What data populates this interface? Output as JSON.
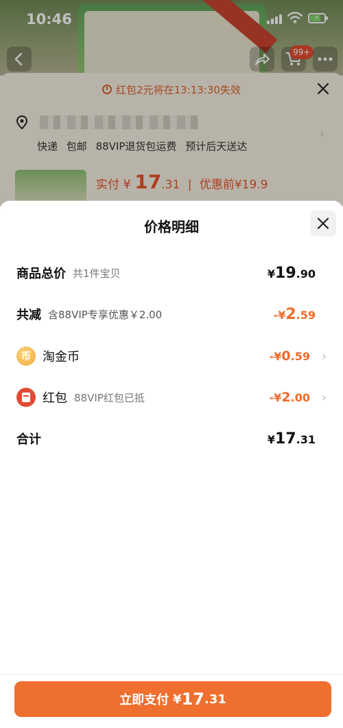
{
  "status_bar": {
    "time": "10:46"
  },
  "header": {
    "cart_badge": "99+"
  },
  "countdown": {
    "text": "红包2元将在13:13:30失效"
  },
  "delivery": {
    "items": [
      "快递",
      "包邮",
      "88VIP退货包运费",
      "预计后天送达"
    ]
  },
  "product_bg": {
    "paid_label": "实付",
    "yen": "¥",
    "price_int": "17",
    "price_dec": ".31",
    "orig_label": "优惠前",
    "orig_price": "¥19.9"
  },
  "modal": {
    "title": "价格明细",
    "rows": {
      "total_goods": {
        "label": "商品总价",
        "sub": "共1件宝贝",
        "yen": "¥",
        "int": "19",
        "dec": ".90"
      },
      "discount": {
        "label": "共减",
        "sub": "含88VIP专享优惠￥2.00",
        "prefix": "-¥",
        "int": "2",
        "dec": ".59"
      },
      "taojinbi": {
        "icon_char": "币",
        "label": "淘金币",
        "prefix": "-¥",
        "int": "0",
        "dec": ".59"
      },
      "hongbao": {
        "label": "红包",
        "sub": "88VIP红包已抵",
        "prefix": "-¥",
        "int": "2",
        "dec": ".00"
      },
      "sum": {
        "label": "合计",
        "yen": "¥",
        "int": "17",
        "dec": ".31"
      }
    }
  },
  "pay_button": {
    "label": "立即支付",
    "yen": "¥",
    "int": "17",
    "dec": ".31"
  },
  "colors": {
    "accent": "#ef6f2f",
    "discount": "#ee6b2c",
    "hongbao": "#e34a33",
    "coin": "#f0a93b"
  },
  "icons": [
    "back-icon",
    "share-icon",
    "cart-icon",
    "more-icon",
    "clock-icon",
    "close-icon",
    "location-pin-icon",
    "coin-icon",
    "red-packet-icon",
    "chevron-right-icon"
  ]
}
